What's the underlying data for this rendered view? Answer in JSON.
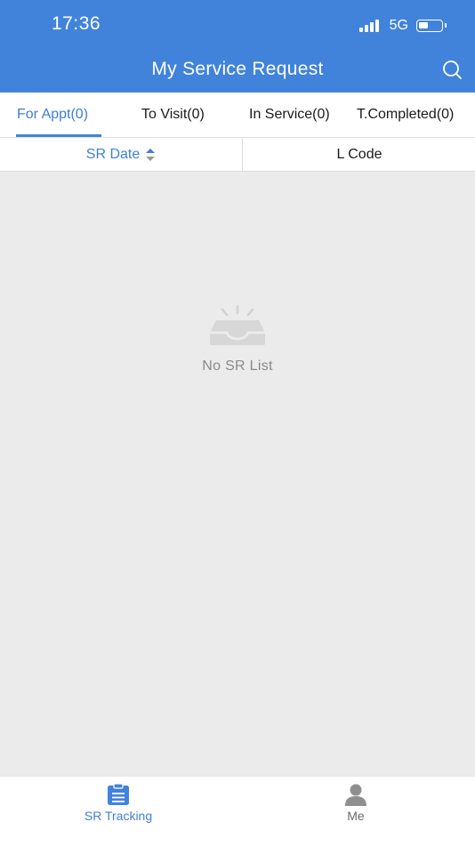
{
  "status_bar": {
    "time": "17:36",
    "network": "5G",
    "signal_bars": 4,
    "battery_level": 0.45
  },
  "header": {
    "title": "My Service Request",
    "search_icon": "search-icon"
  },
  "tabs": [
    {
      "label": "For Appt(0)",
      "active": true
    },
    {
      "label": "To Visit(0)",
      "active": false
    },
    {
      "label": "In Service(0)",
      "active": false
    },
    {
      "label": "T.Completed(0)",
      "active": false
    }
  ],
  "sort_bar": {
    "sr_date": "SR Date",
    "l_code": "L Code"
  },
  "empty_state": {
    "icon": "empty-inbox-icon",
    "text": "No SR List"
  },
  "bottom_nav": {
    "tracking": {
      "label": "SR Tracking",
      "icon": "clipboard-icon",
      "active": true
    },
    "me": {
      "label": "Me",
      "icon": "person-icon",
      "active": false
    }
  },
  "colors": {
    "primary": "#4183db",
    "active_text": "#3f7fd6",
    "background": "#ebebeb",
    "muted_text": "#8a8a8a"
  }
}
